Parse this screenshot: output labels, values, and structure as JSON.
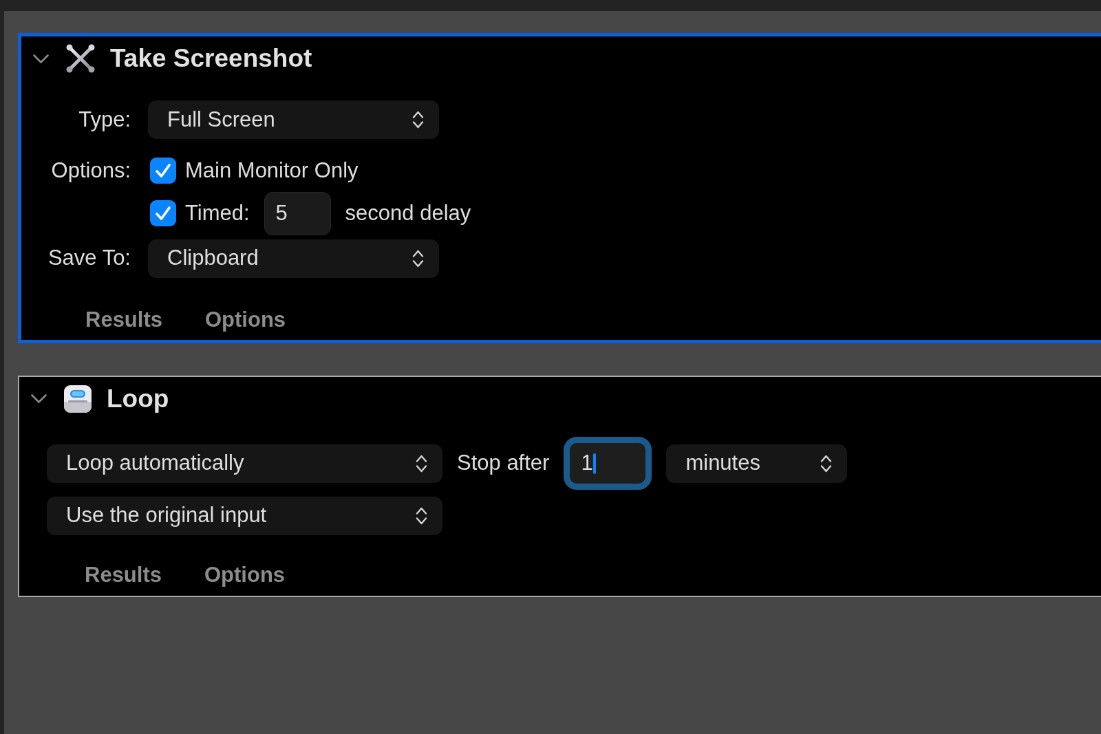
{
  "actions": [
    {
      "kind": "screenshot",
      "title": "Take Screenshot",
      "selected": true,
      "expanded": true,
      "rows": [
        {
          "label": "Type:",
          "controls": [
            {
              "kind": "popup",
              "value": "Full Screen"
            }
          ]
        },
        {
          "label": "Options:",
          "controls": [
            {
              "kind": "checkbox",
              "text": "Main Monitor Only",
              "checked": true
            }
          ]
        },
        {
          "controls": [
            {
              "kind": "checkbox",
              "text": "Timed:",
              "checked": true
            },
            {
              "kind": "field",
              "value": "5",
              "focused": false
            },
            {
              "kind": "text",
              "text": "second delay"
            }
          ]
        },
        {
          "label": "Save To:",
          "controls": [
            {
              "kind": "popup",
              "value": "Clipboard"
            }
          ]
        }
      ],
      "tabs": [
        {
          "label": "Results",
          "selected": false
        },
        {
          "label": "Options",
          "selected": false
        }
      ]
    },
    {
      "kind": "loop",
      "title": "Loop",
      "selected": false,
      "expanded": true,
      "rows": [
        {
          "controls": [
            {
              "kind": "popup",
              "value": "Loop automatically"
            },
            {
              "kind": "text",
              "text": "Stop after"
            },
            {
              "kind": "field",
              "value": "1",
              "focused": true
            },
            {
              "kind": "popup",
              "value": "minutes"
            }
          ]
        },
        {
          "controls": [
            {
              "kind": "popup",
              "value": "Use the original input"
            }
          ]
        }
      ],
      "tabs": [
        {
          "label": "Results",
          "selected": false
        },
        {
          "label": "Options",
          "selected": false
        }
      ]
    }
  ]
}
